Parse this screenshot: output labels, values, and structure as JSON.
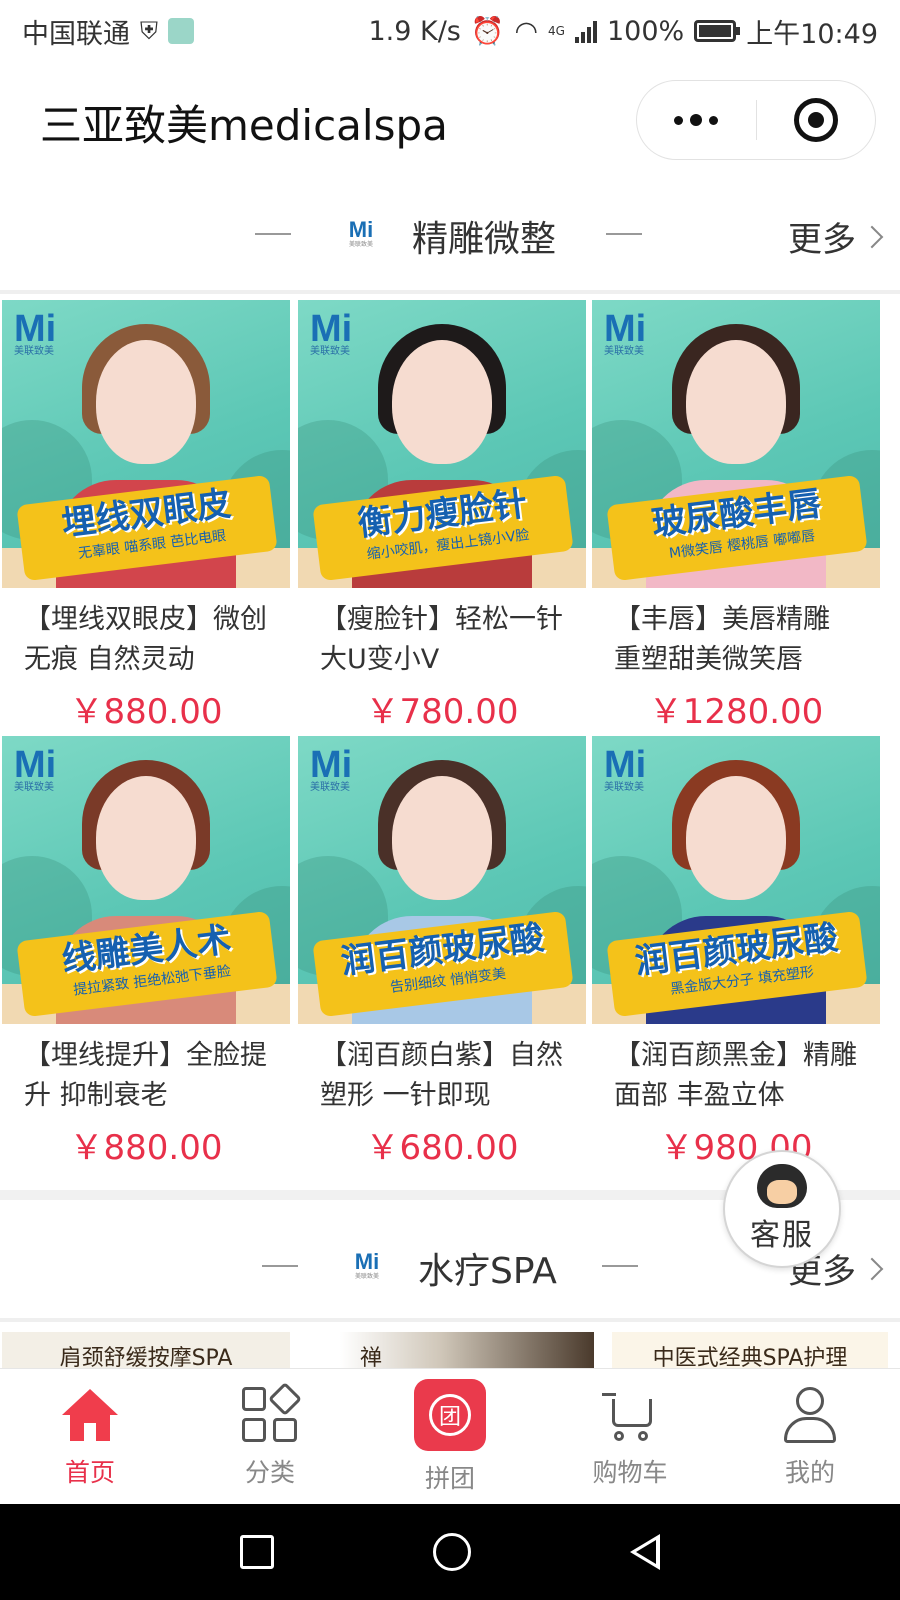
{
  "status_bar": {
    "carrier": "中国联通",
    "speed": "1.9 K/s",
    "network": "4G",
    "battery": "100%",
    "battery_level": 1.0,
    "time": "上午10:49"
  },
  "title_bar": {
    "title": "三亚致美medicalspa"
  },
  "section_1": {
    "logo": "Mi",
    "title": "精雕微整",
    "more": "更多"
  },
  "products": [
    {
      "banner": "埋线双眼皮",
      "banner_sub": "无辜眼 喵系眼 芭比电眼",
      "name": "【埋线双眼皮】微创无痕 自然灵动",
      "price": "￥880.00"
    },
    {
      "banner": "衡力瘦脸针",
      "banner_sub": "缩小咬肌，瘦出上镜小V脸",
      "name": "【瘦脸针】轻松一针 大U变小V",
      "price": "￥780.00"
    },
    {
      "banner": "玻尿酸丰唇",
      "banner_sub": "M微笑唇 樱桃唇 嘟嘟唇",
      "name": "【丰唇】美唇精雕 重塑甜美微笑唇",
      "price": "￥1280.00"
    },
    {
      "banner": "线雕美人术",
      "banner_sub": "提拉紧致 拒绝松弛下垂脸",
      "name": "【埋线提升】全脸提升 抑制衰老",
      "price": "￥880.00"
    },
    {
      "banner": "润百颜玻尿酸",
      "banner_sub": "告别细纹 悄悄变美",
      "name": "【润百颜白紫】自然塑形 一针即现",
      "price": "￥680.00"
    },
    {
      "banner": "润百颜玻尿酸",
      "banner_sub": "黑金版大分子 填充塑形",
      "name": "【润百颜黑金】精雕面部 丰盈立体",
      "price": "￥980.00"
    }
  ],
  "section_2": {
    "logo": "Mi",
    "title": "水疗SPA",
    "more": "更多",
    "previews": [
      "肩颈舒缓按摩SPA",
      "禅",
      "中医式经典SPA护理"
    ]
  },
  "service_button": {
    "label": "客服"
  },
  "tabbar": [
    {
      "label": "首页",
      "icon": "home-icon",
      "active": true
    },
    {
      "label": "分类",
      "icon": "category-icon",
      "active": false
    },
    {
      "label": "拼团",
      "icon": "group-buy-icon",
      "active": false
    },
    {
      "label": "购物车",
      "icon": "cart-icon",
      "active": false
    },
    {
      "label": "我的",
      "icon": "user-icon",
      "active": false
    }
  ],
  "colors": {
    "accent": "#e8304a",
    "tab_active": "#f03d4c",
    "banner_blue": "#1560b0",
    "banner_yellow": "#f4c21a",
    "bg_teal": "#5cc7b5"
  }
}
